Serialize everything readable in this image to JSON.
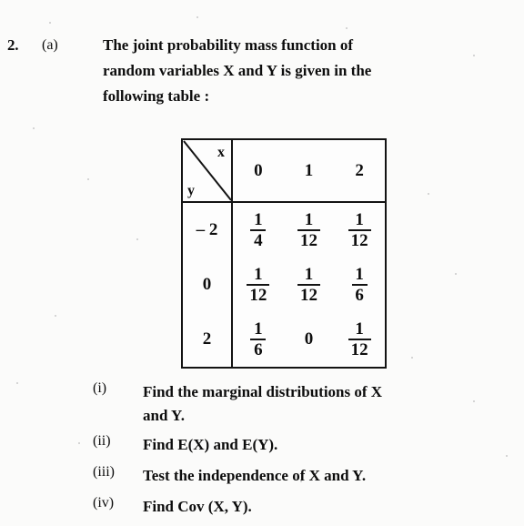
{
  "page": {
    "background_color": "#fbfbfa",
    "ink_color": "#0d0d0d"
  },
  "question": {
    "number": "2.",
    "part": "(a)",
    "stem_line_1": "The joint probability mass function of",
    "stem_line_2": "random variables X and Y is given in the",
    "stem_line_3": "following table :"
  },
  "table": {
    "corner": {
      "x_label": "x",
      "y_label": "y"
    },
    "column_headers": [
      "0",
      "1",
      "2"
    ],
    "row_headers": [
      "– 2",
      "0",
      "2"
    ],
    "cells": [
      [
        {
          "type": "fraction",
          "numerator": "1",
          "denominator": "4"
        },
        {
          "type": "fraction",
          "numerator": "1",
          "denominator": "12"
        },
        {
          "type": "fraction",
          "numerator": "1",
          "denominator": "12"
        }
      ],
      [
        {
          "type": "fraction",
          "numerator": "1",
          "denominator": "12"
        },
        {
          "type": "fraction",
          "numerator": "1",
          "denominator": "12"
        },
        {
          "type": "fraction",
          "numerator": "1",
          "denominator": "6"
        }
      ],
      [
        {
          "type": "fraction",
          "numerator": "1",
          "denominator": "6"
        },
        {
          "type": "plain",
          "value": "0"
        },
        {
          "type": "fraction",
          "numerator": "1",
          "denominator": "12"
        }
      ]
    ]
  },
  "subquestions": [
    {
      "marker": "(i)",
      "line_1": "Find the marginal distributions of X",
      "line_2": "and Y."
    },
    {
      "marker": "(ii)",
      "line_1": "Find E(X) and E(Y).",
      "line_2": ""
    },
    {
      "marker": "(iii)",
      "line_1": "Test the independence of X and Y.",
      "line_2": ""
    },
    {
      "marker": "(iv)",
      "line_1": "Find Cov (X, Y).",
      "line_2": ""
    }
  ]
}
